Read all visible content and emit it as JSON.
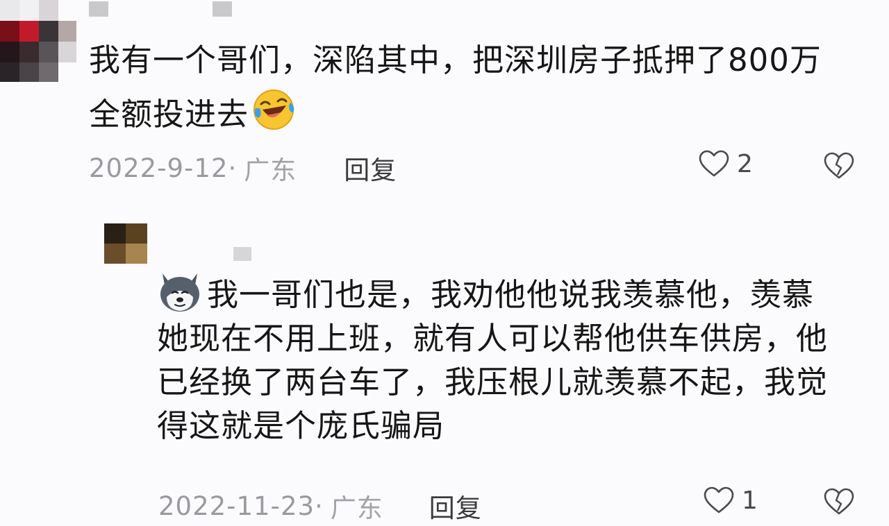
{
  "comment": {
    "text": "我有一个哥们，深陷其中，把深圳房子抵押了800万全额投进去",
    "emoji": "laughing-crying-emoji",
    "date": "2022-9-12·",
    "region": "广东",
    "reply_label": "回复",
    "like_count": "2"
  },
  "reply": {
    "emoji": "husky-dog-emoji",
    "text": "我一哥们也是，我劝他他说我羡慕他，羡慕她现在不用上班，就有人可以帮他供车供房，他已经换了两台车了，我压根儿就羡慕不起，我觉得这就是个庞氏骗局",
    "date": "2022-11-23·",
    "region": "广东",
    "reply_label": "回复",
    "like_count": "1"
  },
  "colors": {
    "background": "#fbfbfd",
    "text": "#161616",
    "meta": "#9a9a9e",
    "emoji_yellow": "#f7c531",
    "emoji_tear": "#3aa0e8"
  }
}
